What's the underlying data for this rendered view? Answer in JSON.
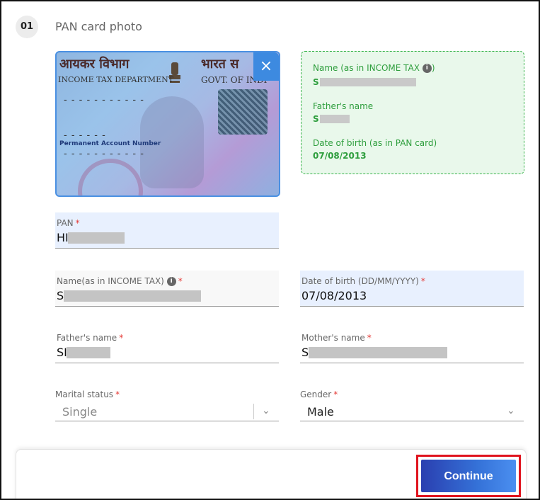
{
  "step": {
    "number": "01",
    "title": "PAN card photo"
  },
  "pan_card_image": {
    "hindi_left": "आयकर विभाग",
    "hindi_right": "भारत स",
    "dept": "INCOME TAX DEPARTMENT",
    "govt": "GOVT. OF INDI",
    "pan_label": "Permanent Account Number",
    "close_icon": "×"
  },
  "extracted": {
    "name_label": "Name (as in INCOME TAX",
    "name_label_suffix": ")",
    "name_value": "S",
    "father_label": "Father's name",
    "father_value": "S",
    "dob_label": "Date of birth (as in PAN card)",
    "dob_value": "07/08/2013"
  },
  "form": {
    "pan": {
      "label": "PAN",
      "value": "HI"
    },
    "name": {
      "label": "Name(as in INCOME TAX)",
      "value": "S"
    },
    "dob": {
      "label": "Date of birth (DD/MM/YYYY)",
      "value": "07/08/2013"
    },
    "father": {
      "label": "Father's name",
      "value": "SI"
    },
    "mother": {
      "label": "Mother's name",
      "value": "S"
    },
    "marital": {
      "label": "Marital status",
      "value": "Single"
    },
    "gender": {
      "label": "Gender",
      "value": "Male"
    },
    "required_mark": "*"
  },
  "footer": {
    "continue_label": "Continue"
  },
  "colors": {
    "accent": "#3d8ae0",
    "success": "#2e9e3d",
    "required": "#e53935",
    "highlight": "#e0141e"
  }
}
